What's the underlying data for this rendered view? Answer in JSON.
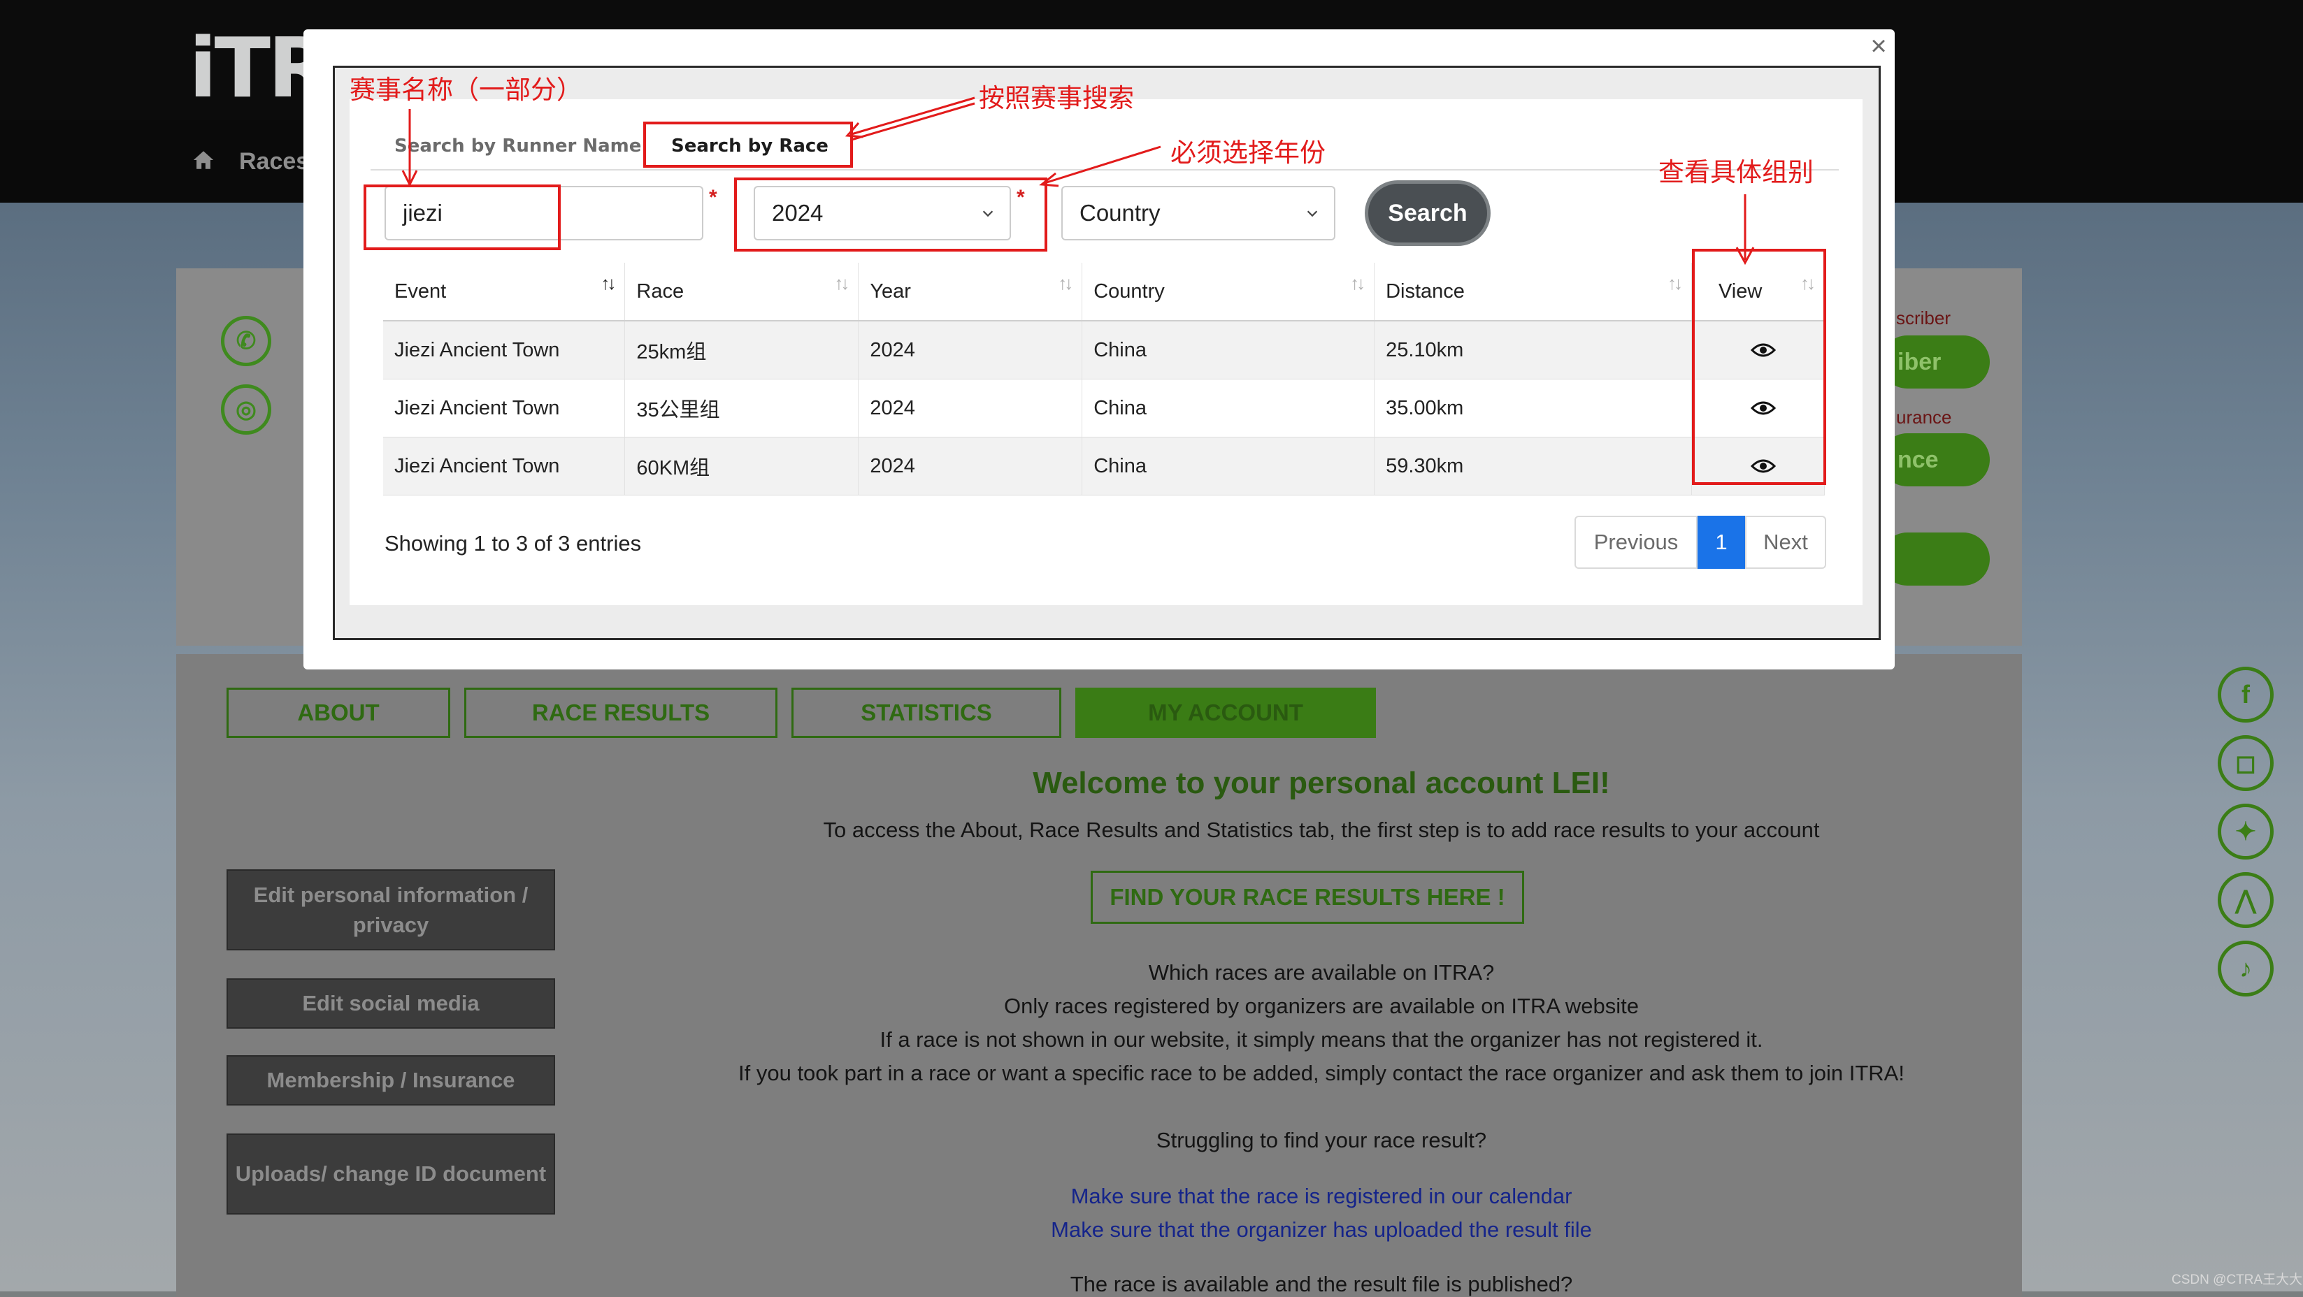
{
  "site": {
    "logo": "iTR",
    "nav_races": "Races"
  },
  "profile_side": {
    "subscriber_label": "scriber",
    "subscriber_btn": "iber",
    "insurance_label": "urance",
    "insurance_btn": "nce"
  },
  "tabs": [
    "ABOUT",
    "RACE RESULTS",
    "STATISTICS",
    "MY ACCOUNT"
  ],
  "account": {
    "welcome": "Welcome to your personal account LEI!",
    "intro": "To access the About, Race Results and Statistics tab, the first step is to add race results to your account",
    "find_btn": "FIND YOUR RACE RESULTS HERE !",
    "q1": "Which races are available on ITRA?",
    "p1": "Only races registered by organizers are available on ITRA website",
    "p2": "If a race is not shown in our website, it simply means that the organizer has not registered it.",
    "p3": "If you took part in a race or want a specific race to be added, simply contact the race organizer and ask them to join ITRA!",
    "q2": "Struggling to find your race result?",
    "link1": "Make sure that the race is registered in our calendar",
    "link2": "Make sure that the organizer has uploaded the result file",
    "q3": "The race is available and the result file is published?"
  },
  "side_menu": [
    "Edit personal information / privacy",
    "Edit social media",
    "Membership / Insurance",
    "Uploads/ change ID document"
  ],
  "modal": {
    "close": "×",
    "tab_runner": "Search by Runner Name",
    "tab_race": "Search by Race",
    "race_name_value": "jiezi",
    "year_value": "2024",
    "country_value": "Country",
    "asterisk": "*",
    "search_btn": "Search",
    "columns": [
      "Event",
      "Race",
      "Year",
      "Country",
      "Distance",
      "View"
    ],
    "rows": [
      [
        "Jiezi Ancient Town",
        "25km组",
        "2024",
        "China",
        "25.10km"
      ],
      [
        "Jiezi Ancient Town",
        "35公里组",
        "2024",
        "China",
        "35.00km"
      ],
      [
        "Jiezi Ancient Town",
        "60KM组",
        "2024",
        "China",
        "59.30km"
      ]
    ],
    "showing": "Showing 1 to 3 of 3 entries",
    "pagination": {
      "previous": "Previous",
      "current": "1",
      "next": "Next"
    }
  },
  "annotations": {
    "race_name_part": "赛事名称（一部分）",
    "search_by_race": "按照赛事搜索",
    "must_choose_year": "必须选择年份",
    "view_groups": "查看具体组别"
  },
  "watermark": "CSDN @CTRA王大大",
  "colors": {
    "annotation_red": "#e21b1b",
    "brand_green": "#3b7d16",
    "active_page": "#1a73e8",
    "search_btn": "#4a4f53"
  }
}
